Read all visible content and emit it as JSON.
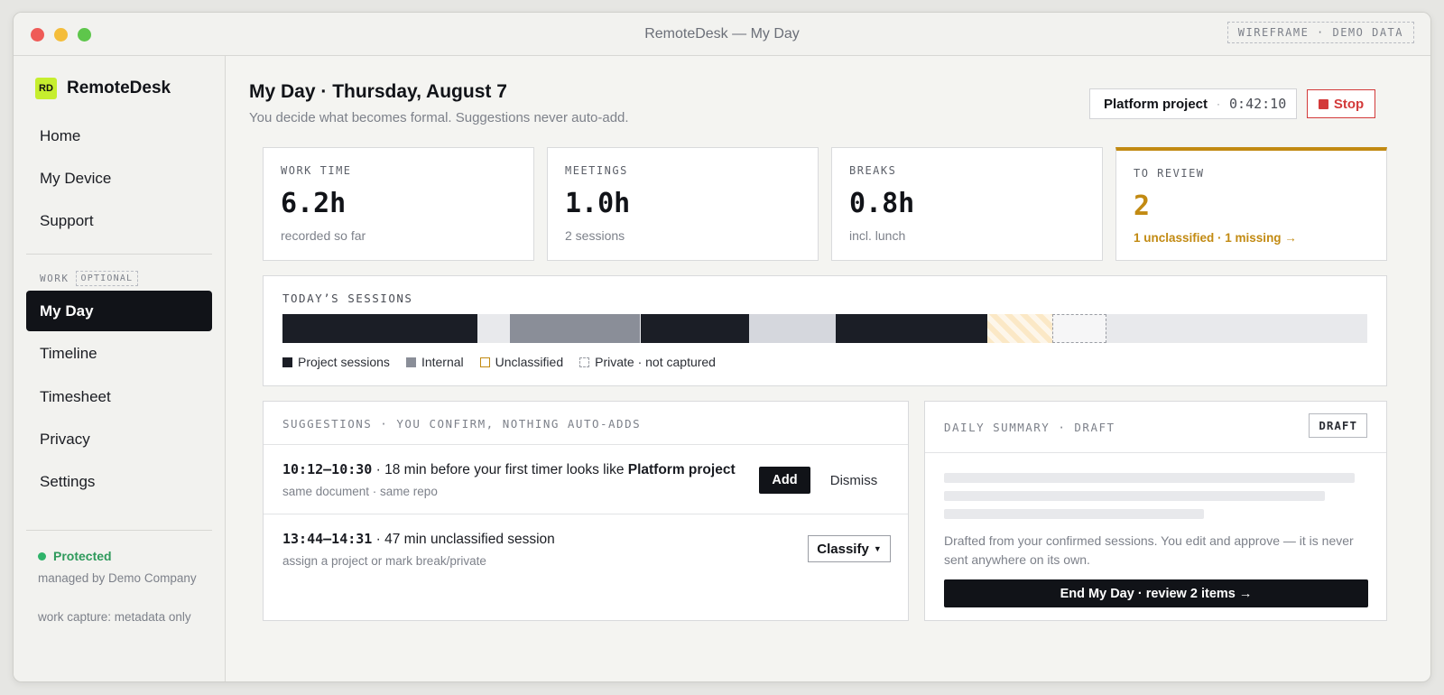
{
  "window": {
    "title": "RemoteDesk — My Day",
    "badge": "WIREFRAME · DEMO DATA"
  },
  "sidebar": {
    "logo_mark": "RD",
    "logo_text": "RemoteDesk",
    "top_items": [
      {
        "label": "Home"
      },
      {
        "label": "My Device"
      },
      {
        "label": "Support"
      }
    ],
    "section_label": "WORK",
    "section_badge": "OPTIONAL",
    "work_items": [
      {
        "label": "My Day",
        "active": true
      },
      {
        "label": "Timeline"
      },
      {
        "label": "Timesheet"
      },
      {
        "label": "Privacy"
      },
      {
        "label": "Settings"
      }
    ],
    "status": {
      "label": "Protected",
      "color": "#2fb36a"
    },
    "managed_by": "managed by Demo Company",
    "capture": "work capture: metadata only"
  },
  "header": {
    "title": "My Day · Thursday, August 7",
    "subtitle": "You decide what becomes formal. Suggestions never auto-add.",
    "timer_project": "Platform project",
    "timer_sep": "·",
    "timer_time": "0:42:10",
    "stop_label": "Stop"
  },
  "stats": [
    {
      "label": "WORK TIME",
      "value": "6.2h",
      "sub": "recorded so far"
    },
    {
      "label": "MEETINGS",
      "value": "1.0h",
      "sub": "2 sessions"
    },
    {
      "label": "BREAKS",
      "value": "0.8h",
      "sub": "incl. lunch"
    },
    {
      "label": "TO REVIEW",
      "value": "2",
      "sub": "1 unclassified · 1 missing →",
      "accent": "#c28a12"
    }
  ],
  "sessions": {
    "title": "TODAY’S SESSIONS",
    "segments": [
      {
        "kind": "project",
        "start": 0.0,
        "end": 0.18
      },
      {
        "kind": "gap",
        "start": 0.18,
        "end": 0.21
      },
      {
        "kind": "internal",
        "start": 0.21,
        "end": 0.33
      },
      {
        "kind": "project",
        "start": 0.33,
        "end": 0.43
      },
      {
        "kind": "light",
        "start": 0.43,
        "end": 0.51
      },
      {
        "kind": "project",
        "start": 0.51,
        "end": 0.65
      },
      {
        "kind": "unclassified",
        "start": 0.65,
        "end": 0.71
      },
      {
        "kind": "private",
        "start": 0.71,
        "end": 0.76
      }
    ],
    "legend": [
      {
        "kind": "project",
        "label": "Project sessions"
      },
      {
        "kind": "internal",
        "label": "Internal"
      },
      {
        "kind": "unclassified",
        "label": "Unclassified"
      },
      {
        "kind": "private",
        "label": "Private · not captured"
      }
    ],
    "colors": {
      "project": "#1b1e26",
      "internal": "#8a8e98",
      "light": "#d5d7dd",
      "gap": "#e8e9ec",
      "unclassified": "#c28a12"
    }
  },
  "suggestions": {
    "title": "SUGGESTIONS · YOU CONFIRM, NOTHING AUTO-ADDS",
    "items": [
      {
        "time": "10:12–10:30",
        "text": " · 18 min before your first timer looks like ",
        "bold": "Platform project",
        "sub": "same document · same repo",
        "primary": "Add",
        "secondary": "Dismiss"
      },
      {
        "time": "13:44–14:31",
        "text": " · 47 min unclassified session",
        "bold": "",
        "sub": "assign a project or mark break/private",
        "primary": "Classify"
      }
    ]
  },
  "summary": {
    "title": "DAILY SUMMARY · DRAFT",
    "badge": "DRAFT",
    "text": "Drafted from your confirmed sessions. You edit and approve — it is never sent anywhere on its own.",
    "cta": "End My Day · review 2 items →"
  }
}
